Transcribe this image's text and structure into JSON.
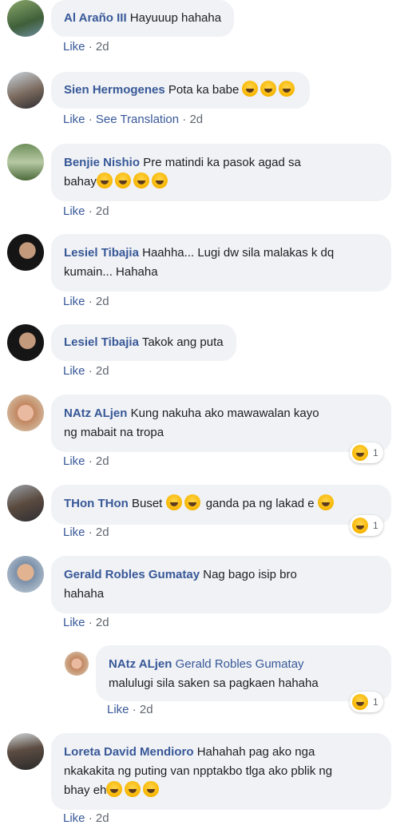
{
  "comments": [
    {
      "name": "Al Araño III",
      "text": "Hayuuup hahaha",
      "like": "Like",
      "sep": "·",
      "time": "2d"
    },
    {
      "name": "Sien Hermogenes",
      "text": "Pota ka babe",
      "like": "Like",
      "translate": "See Translation",
      "sep": "·",
      "time": "2d"
    },
    {
      "name": "Benjie Nishio",
      "text": "Pre matindi ka pasok agad sa",
      "text2": "bahay",
      "like": "Like",
      "sep": "·",
      "time": "2d"
    },
    {
      "name": "Lesiel Tibajia",
      "text": "Haahha... Lugi dw sila malakas k dq",
      "text2": "kumain... Hahaha",
      "like": "Like",
      "sep": "·",
      "time": "2d"
    },
    {
      "name": "Lesiel Tibajia",
      "text": "Takok ang puta",
      "like": "Like",
      "sep": "·",
      "time": "2d"
    },
    {
      "name": "NAtz ALjen",
      "text": "Kung nakuha ako mawawalan kayo",
      "text2": "ng mabait na tropa",
      "like": "Like",
      "sep": "·",
      "time": "2d",
      "reactions": "1"
    },
    {
      "name": "THon THon",
      "text": "Buset",
      "text_b": "ganda pa ng lakad e",
      "like": "Like",
      "sep": "·",
      "time": "2d",
      "reactions": "1"
    },
    {
      "name": "Gerald Robles Gumatay",
      "text": "Nag bago isip bro",
      "text2": "hahaha",
      "like": "Like",
      "sep": "·",
      "time": "2d"
    },
    {
      "name": "NAtz ALjen",
      "mention": "Gerald Robles Gumatay",
      "text2": "malulugi sila saken sa pagkaen hahaha",
      "like": "Like",
      "sep": "·",
      "time": "2d",
      "reactions": "1"
    },
    {
      "name": "Loreta David Mendioro",
      "text": "Hahahah pag ako nga",
      "text2": "nkakakita ng puting van npptakbo tlga ako pblik ng",
      "text3": "bhay eh",
      "like": "Like",
      "sep": "·",
      "time": "2d"
    }
  ],
  "colors": {
    "name": "#385898",
    "bubble": "#f0f2f5",
    "meta": "#606770"
  }
}
